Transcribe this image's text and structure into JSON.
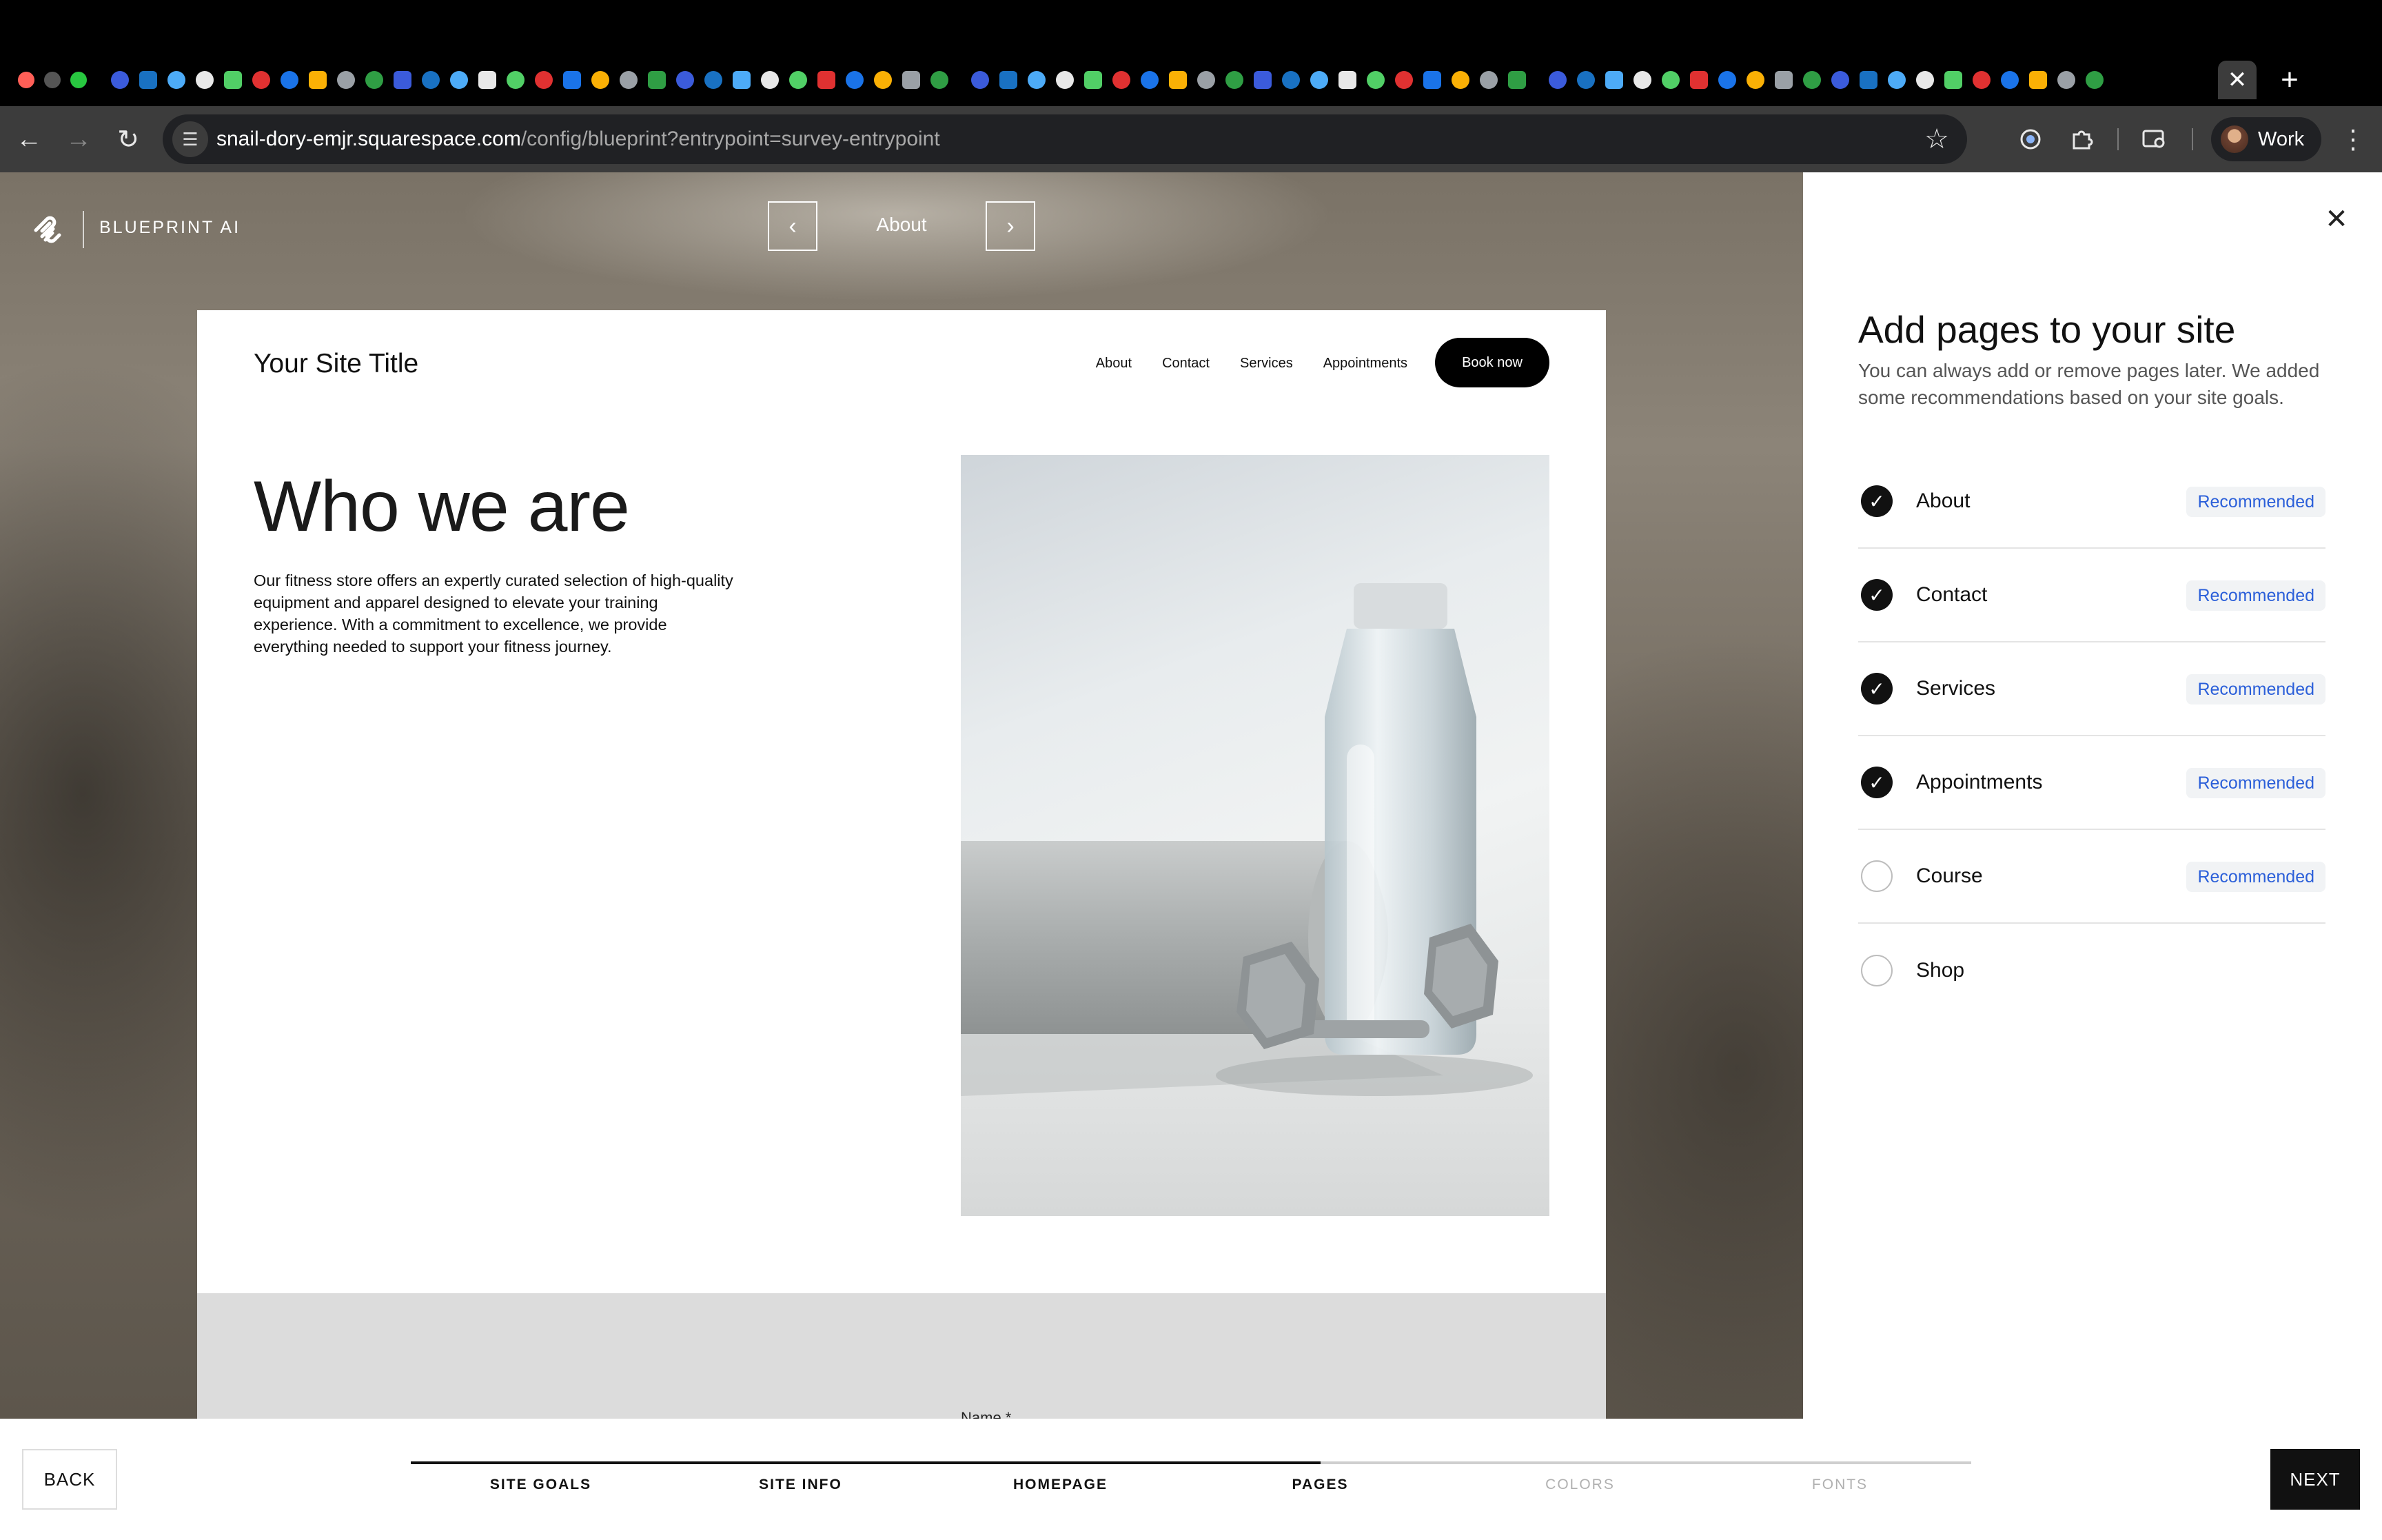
{
  "browser": {
    "url_host": "snail-dory-emjr.squarespace.com",
    "url_path": "/config/blueprint?entrypoint=survey-entrypoint",
    "profile_label": "Work",
    "tab_close_glyph": "✕",
    "new_tab_glyph": "+"
  },
  "preview": {
    "brand_label": "BLUEPRINT AI",
    "current_page": "About",
    "site": {
      "title": "Your Site Title",
      "nav": [
        "About",
        "Contact",
        "Services",
        "Appointments"
      ],
      "cta": "Book now",
      "heading": "Who we are",
      "body": "Our fitness store offers an expertly curated selection of high-quality equipment and apparel designed to elevate your training experience. With a commitment to excellence, we provide everything needed to support your fitness journey.",
      "footer_field_label": "Name *"
    }
  },
  "panel": {
    "heading": "Add pages to your site",
    "subheading": "You can always add or remove pages later. We added some recommendations based on your site goals.",
    "pages": [
      {
        "label": "About",
        "checked": true,
        "badge": "Recommended"
      },
      {
        "label": "Contact",
        "checked": true,
        "badge": "Recommended"
      },
      {
        "label": "Services",
        "checked": true,
        "badge": "Recommended"
      },
      {
        "label": "Appointments",
        "checked": true,
        "badge": "Recommended"
      },
      {
        "label": "Course",
        "checked": false,
        "badge": "Recommended"
      },
      {
        "label": "Shop",
        "checked": false,
        "badge": ""
      }
    ]
  },
  "footer": {
    "back_label": "BACK",
    "next_label": "NEXT",
    "steps": [
      {
        "label": "SITE GOALS",
        "done": true
      },
      {
        "label": "SITE INFO",
        "done": true
      },
      {
        "label": "HOMEPAGE",
        "done": true
      },
      {
        "label": "PAGES",
        "done": true
      },
      {
        "label": "COLORS",
        "done": false
      },
      {
        "label": "FONTS",
        "done": false
      }
    ],
    "progress_fraction": 0.583
  },
  "colors": {
    "accent_blue": "#2b5fd9",
    "dark": "#111111",
    "badge_bg": "#f1f3f5"
  }
}
